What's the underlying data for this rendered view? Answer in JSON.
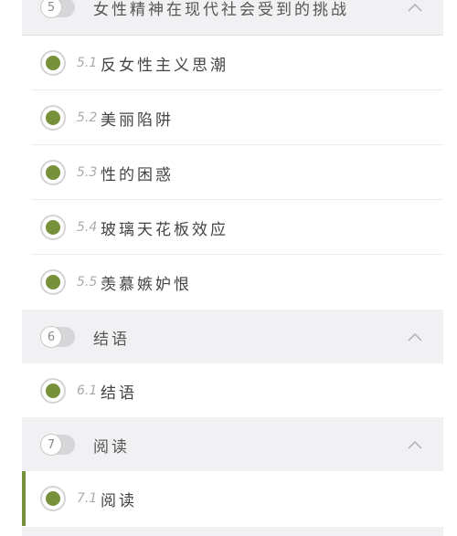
{
  "chapters": [
    {
      "number": "5",
      "title": "女性精神在现代社会受到的挑战"
    },
    {
      "number": "6",
      "title": "结语"
    },
    {
      "number": "7",
      "title": "阅读"
    }
  ],
  "sections": [
    {
      "number": "5.1",
      "label": "反女性主义思潮"
    },
    {
      "number": "5.2",
      "label": "美丽陷阱"
    },
    {
      "number": "5.3",
      "label": "性的困惑"
    },
    {
      "number": "5.4",
      "label": "玻璃天花板效应"
    },
    {
      "number": "5.5",
      "label": "羡慕嫉妒恨"
    },
    {
      "number": "6.1",
      "label": "结语"
    },
    {
      "number": "7.1",
      "label": "阅读"
    }
  ],
  "colors": {
    "accent_green": "#76913a",
    "chapter_bg": "#f1f1f3"
  },
  "icons": {
    "chapter_toggle": "chevron-up-icon",
    "section_status": "completed-dot-icon"
  }
}
